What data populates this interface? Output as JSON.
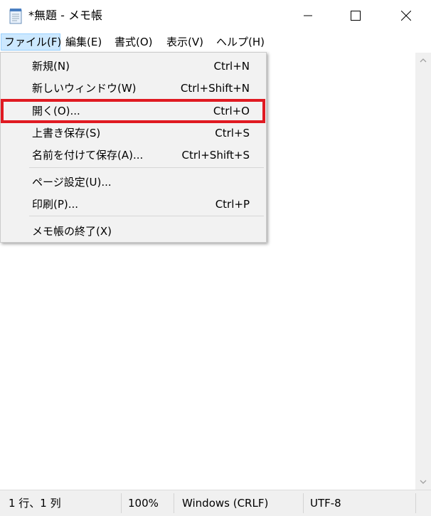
{
  "window": {
    "title": "*無題 - メモ帳",
    "icon": "notepad-icon"
  },
  "menubar": {
    "items": [
      {
        "label": "ファイル(F)",
        "active": true
      },
      {
        "label": "編集(E)"
      },
      {
        "label": "書式(O)"
      },
      {
        "label": "表示(V)"
      },
      {
        "label": "ヘルプ(H)"
      }
    ]
  },
  "file_menu": {
    "items": [
      {
        "label": "新規(N)",
        "shortcut": "Ctrl+N"
      },
      {
        "label": "新しいウィンドウ(W)",
        "shortcut": "Ctrl+Shift+N"
      },
      {
        "label": "開く(O)...",
        "shortcut": "Ctrl+O",
        "highlighted": true
      },
      {
        "label": "上書き保存(S)",
        "shortcut": "Ctrl+S"
      },
      {
        "label": "名前を付けて保存(A)...",
        "shortcut": "Ctrl+Shift+S"
      },
      {
        "label": "ページ設定(U)...",
        "shortcut": ""
      },
      {
        "label": "印刷(P)...",
        "shortcut": "Ctrl+P"
      },
      {
        "label": "メモ帳の終了(X)",
        "shortcut": ""
      }
    ]
  },
  "statusbar": {
    "position": "1 行、1 列",
    "zoom": "100%",
    "line_ending": "Windows (CRLF)",
    "encoding": "UTF-8"
  },
  "colors": {
    "highlight_border": "#e01a22",
    "menu_active_bg": "#cce8ff"
  }
}
